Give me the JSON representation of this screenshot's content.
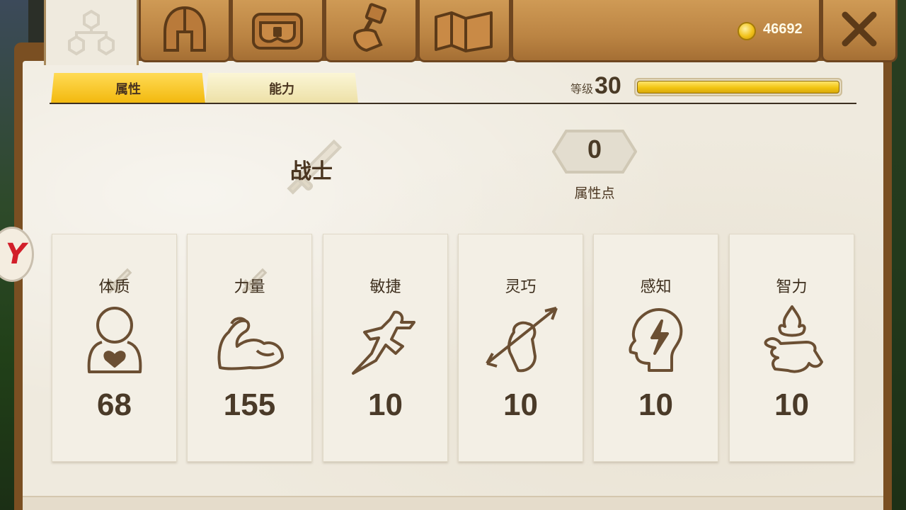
{
  "currency": {
    "gold": "46692",
    "icon": "gold-coin-icon"
  },
  "top_tabs": [
    {
      "name": "skill-tree-tab",
      "icon": "skill-tree-icon",
      "active": true
    },
    {
      "name": "helmet-tab",
      "icon": "helmet-icon",
      "active": false
    },
    {
      "name": "inventory-tab",
      "icon": "chest-icon",
      "active": false
    },
    {
      "name": "crafting-tab",
      "icon": "hammer-fist-icon",
      "active": false
    },
    {
      "name": "map-tab",
      "icon": "map-icon",
      "active": false
    }
  ],
  "sub_tabs": {
    "attributes": "属性",
    "abilities": "能力"
  },
  "level": {
    "label": "等级",
    "value": "30",
    "progress": 1.0
  },
  "character": {
    "class_name": "战士",
    "class_icon": "sword-icon"
  },
  "attribute_points": {
    "value": "0",
    "label": "属性点"
  },
  "stats": [
    {
      "label": "体质",
      "value": "68",
      "icon": "body-heart-icon",
      "class_bonus": true
    },
    {
      "label": "力量",
      "value": "155",
      "icon": "flexed-arm-icon",
      "class_bonus": true
    },
    {
      "label": "敏捷",
      "value": "10",
      "icon": "running-figure-icon",
      "class_bonus": false
    },
    {
      "label": "灵巧",
      "value": "10",
      "icon": "hand-arrow-icon",
      "class_bonus": false
    },
    {
      "label": "感知",
      "value": "10",
      "icon": "head-lightning-icon",
      "class_bonus": false
    },
    {
      "label": "智力",
      "value": "10",
      "icon": "hand-flame-icon",
      "class_bonus": false
    }
  ],
  "side_badge": {
    "text": "Y"
  },
  "colors": {
    "accent": "#f2c512",
    "wood": "#bb8443",
    "text": "#4a3a26"
  }
}
